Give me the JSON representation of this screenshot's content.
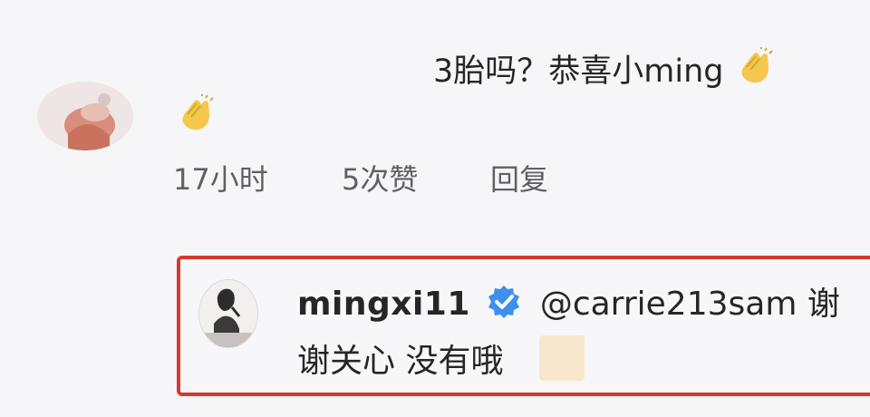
{
  "comment": {
    "text_line1": "3胎吗？恭喜小ming",
    "meta": {
      "time": "17小时",
      "likes": "5次赞",
      "reply": "回复"
    }
  },
  "reply": {
    "username": "mingxi11",
    "mention": "@carrie213sam 谢",
    "text_line2": "谢关心 没有哦"
  },
  "icons": {
    "clap": "clapping-hands-icon",
    "verified": "verified-badge-icon",
    "reply_emoji": "emoji-icon"
  },
  "colors": {
    "highlight_border": "#d9382e",
    "verified_blue": "#3d8ff0",
    "meta_gray": "#5f5f67"
  }
}
